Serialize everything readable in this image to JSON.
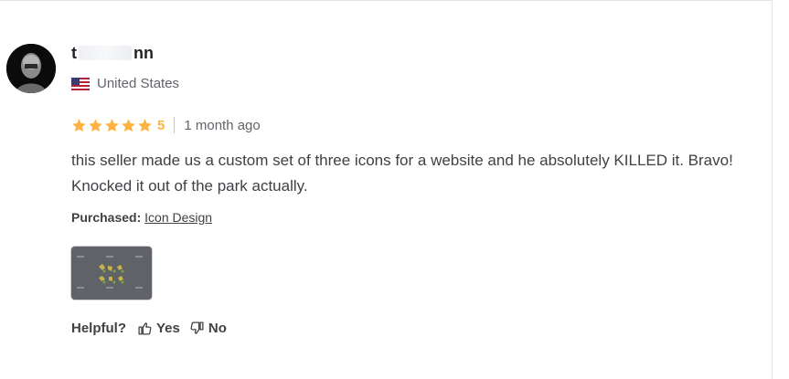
{
  "reviewer": {
    "name_start": "t",
    "name_end": "nn",
    "country": "United States"
  },
  "rating": {
    "value": "5",
    "stars": 5,
    "time_ago": "1 month ago",
    "star_color": "#ffb33e"
  },
  "review": {
    "text": "this seller made us a custom set of three icons for a website and he absolutely KILLED it. Bravo! Knocked it out of the park actually."
  },
  "purchased": {
    "label": "Purchased:",
    "item": "Icon Design"
  },
  "helpful": {
    "label": "Helpful?",
    "yes": "Yes",
    "no": "No"
  }
}
